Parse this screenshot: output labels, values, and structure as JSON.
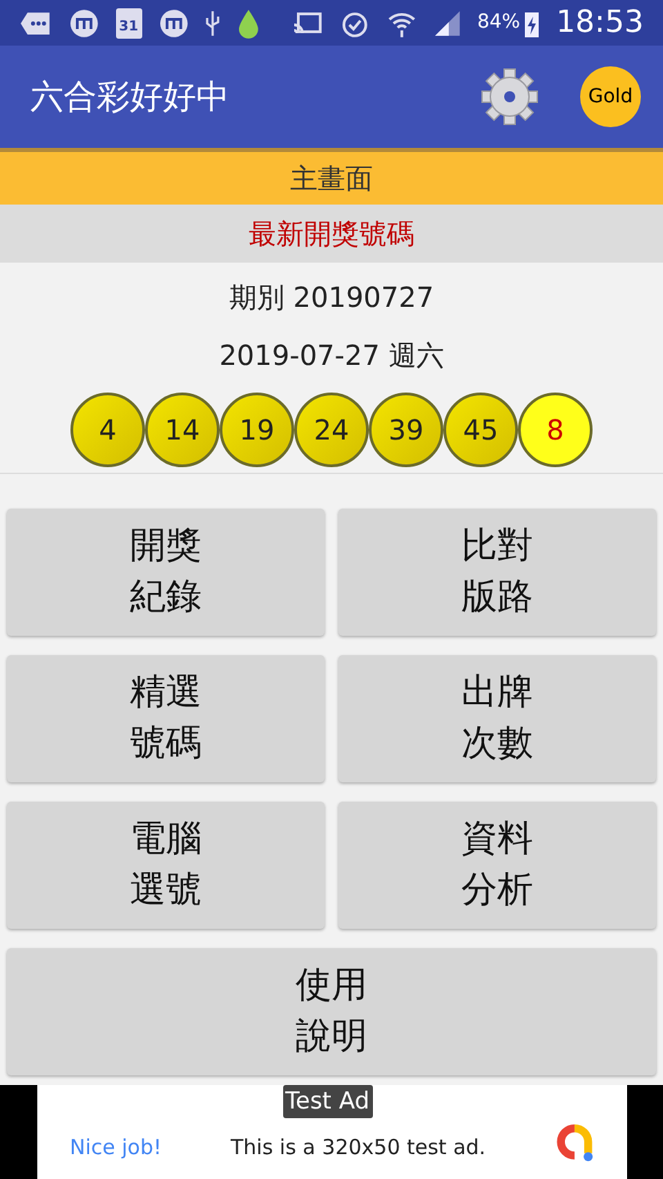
{
  "status_bar": {
    "calendar_day": "31",
    "battery": "84%",
    "time": "18:53"
  },
  "app_bar": {
    "title": "六合彩好好中",
    "badge": "Gold"
  },
  "section_bar": {
    "title": "主畫面"
  },
  "latest": {
    "heading": "最新開獎號碼",
    "period": "期別 20190727",
    "date": "2019-07-27 週六",
    "balls": [
      {
        "number": "4",
        "kind": "regular"
      },
      {
        "number": "14",
        "kind": "regular"
      },
      {
        "number": "19",
        "kind": "regular"
      },
      {
        "number": "24",
        "kind": "regular"
      },
      {
        "number": "39",
        "kind": "regular"
      },
      {
        "number": "45",
        "kind": "regular"
      },
      {
        "number": "8",
        "kind": "special"
      }
    ]
  },
  "menu_buttons": [
    {
      "label": "開獎紀錄",
      "wide": false
    },
    {
      "label": "比對版路",
      "wide": false
    },
    {
      "label": "精選號碼",
      "wide": false
    },
    {
      "label": "出牌次數",
      "wide": false
    },
    {
      "label": "電腦選號",
      "wide": false
    },
    {
      "label": "資料分析",
      "wide": false
    },
    {
      "label": "使用說明",
      "wide": true
    }
  ],
  "ad": {
    "tag": "Test Ad",
    "headline": "Nice job!",
    "text": "This is a 320x50 test ad."
  }
}
